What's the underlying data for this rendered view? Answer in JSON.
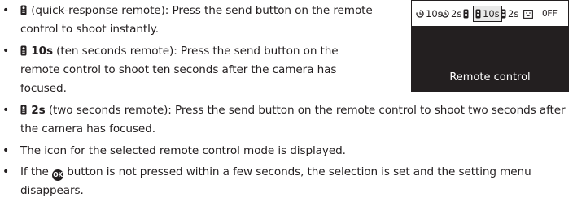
{
  "camera_screen": {
    "menu_options": [
      {
        "name": "self-timer-10s",
        "label": "10s",
        "icon": "self-timer-icon",
        "selected": false
      },
      {
        "name": "self-timer-2s",
        "label": "2s",
        "icon": "self-timer-icon",
        "selected": false
      },
      {
        "name": "remote-quick",
        "label": "",
        "icon": "remote-icon",
        "selected": false
      },
      {
        "name": "remote-10s",
        "label": "10s",
        "icon": "remote-icon",
        "selected": true
      },
      {
        "name": "remote-2s",
        "label": "2s",
        "icon": "remote-icon",
        "selected": false
      },
      {
        "name": "smile-timer",
        "label": "",
        "icon": "smile-timer-icon",
        "selected": false
      },
      {
        "name": "off",
        "label": "OFF",
        "icon": "",
        "selected": false
      }
    ],
    "label": "Remote control"
  },
  "items": [
    {
      "title": "",
      "text": " (quick-response remote): Press the send button on the remote control to shoot instantly."
    },
    {
      "title": "10s",
      "text": " (ten seconds remote): Press the send button on the remote control to shoot ten seconds after the camera has focused."
    },
    {
      "title": "2s",
      "text": " (two seconds remote): Press the send button on the remote control to shoot two seconds after the camera has focused."
    },
    {
      "title": "",
      "text": "The icon for the selected remote control mode is displayed."
    },
    {
      "text_before": "If the ",
      "ok_label": "OK",
      "text_after": " button is not pressed within a few seconds, the selection is set and the setting menu disappears."
    }
  ]
}
